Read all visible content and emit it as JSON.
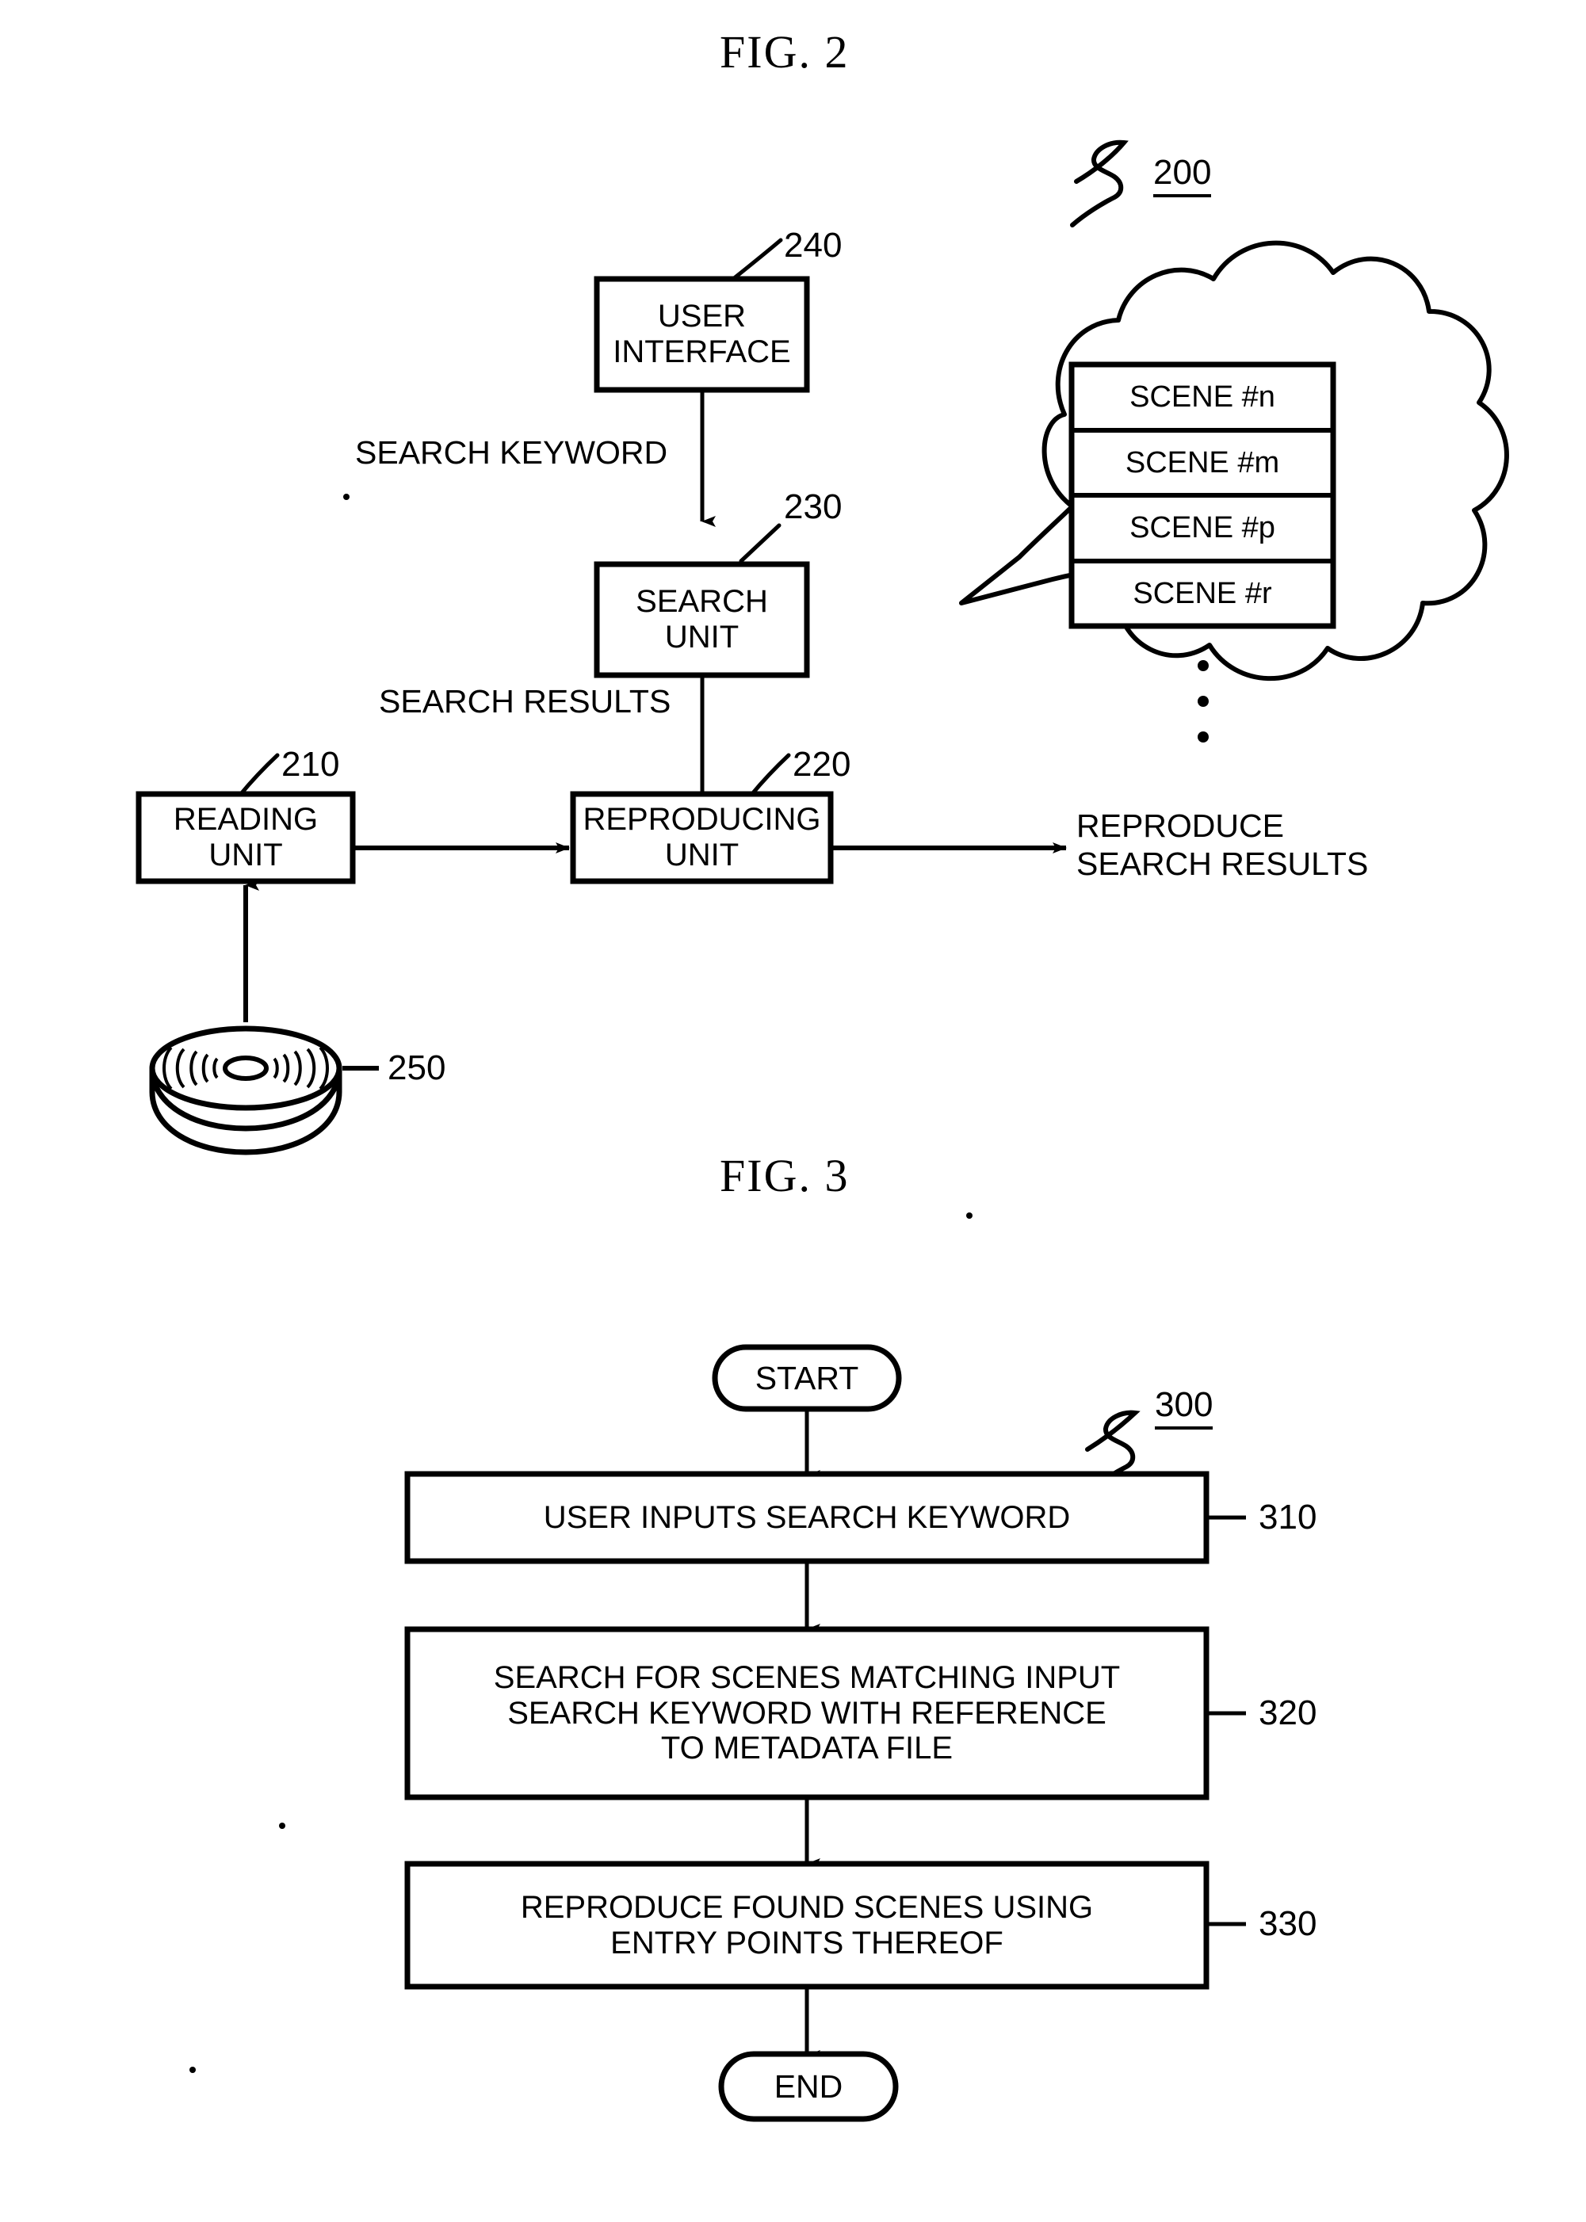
{
  "figures": [
    {
      "title": "FIG. 2",
      "system_ref": "200",
      "blocks": [
        {
          "id": "user-interface",
          "label": "USER\nINTERFACE",
          "ref": "240"
        },
        {
          "id": "search-unit",
          "label": "SEARCH\nUNIT",
          "ref": "230"
        },
        {
          "id": "reading-unit",
          "label": "READING\nUNIT",
          "ref": "210"
        },
        {
          "id": "reproducing-unit",
          "label": "REPRODUCING\nUNIT",
          "ref": "220"
        }
      ],
      "edge_labels": [
        {
          "id": "search-keyword",
          "label": "SEARCH KEYWORD"
        },
        {
          "id": "search-results",
          "label": "SEARCH RESULTS"
        }
      ],
      "output_label": "REPRODUCE\nSEARCH RESULTS",
      "disc": {
        "ref": "250",
        "icon": "optical-disc-icon"
      },
      "cloud": {
        "icon": "cloud-callout",
        "scenes": [
          "SCENE #n",
          "SCENE #m",
          "SCENE #p",
          "SCENE #r"
        ],
        "ellipsis": "vertical-ellipsis"
      }
    },
    {
      "title": "FIG. 3",
      "system_ref": "300",
      "terminators": {
        "start": "START",
        "end": "END"
      },
      "steps": [
        {
          "ref": "310",
          "label": "USER INPUTS SEARCH KEYWORD",
          "lines": [
            "USER INPUTS SEARCH KEYWORD"
          ]
        },
        {
          "ref": "320",
          "label": "SEARCH FOR SCENES MATCHING INPUT SEARCH KEYWORD WITH REFERENCE TO METADATA FILE",
          "lines": [
            "SEARCH FOR SCENES MATCHING INPUT",
            "SEARCH KEYWORD WITH REFERENCE",
            "TO METADATA FILE"
          ]
        },
        {
          "ref": "330",
          "label": "REPRODUCE FOUND SCENES USING ENTRY POINTS THEREOF",
          "lines": [
            "REPRODUCE FOUND SCENES USING",
            "ENTRY POINTS THEREOF"
          ]
        }
      ]
    }
  ],
  "colors": {
    "ink": "#000000",
    "paper": "#ffffff"
  }
}
